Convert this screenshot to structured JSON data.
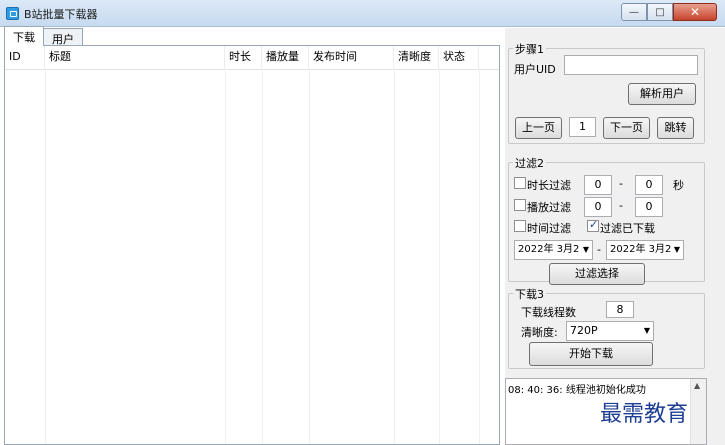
{
  "window": {
    "title": "B站批量下载器",
    "buttons": {
      "minimize": "—",
      "maximize": "□",
      "close": "✕"
    }
  },
  "tabs": [
    {
      "label": "下载",
      "active": true
    },
    {
      "label": "用户",
      "active": false
    }
  ],
  "list": {
    "columns": [
      "ID",
      "标题",
      "时长",
      "播放量",
      "发布时间",
      "清晰度",
      "状态"
    ],
    "rows": []
  },
  "step1": {
    "legend": "步骤1",
    "uid_label": "用户UID",
    "uid_value": "",
    "parse_button": "解析用户",
    "prev_button": "上一页",
    "page_value": "1",
    "next_button": "下一页",
    "jump_button": "跳转"
  },
  "step2": {
    "legend": "过滤2",
    "duration_filter": {
      "label": "时长过滤",
      "checked": false,
      "from": "0",
      "sep": "-",
      "to": "0",
      "unit": "秒"
    },
    "play_filter": {
      "label": "播放过滤",
      "checked": false,
      "from": "0",
      "sep": "-",
      "to": "0"
    },
    "time_filter": {
      "label": "时间过滤",
      "checked": false
    },
    "downloaded_filter": {
      "label": "过滤已下载",
      "checked": true
    },
    "date_from": "2022年 3月2",
    "date_sep": "-",
    "date_to": "2022年 3月2",
    "filter_button": "过滤选择"
  },
  "step3": {
    "legend": "下载3",
    "threads_label": "下载线程数",
    "threads_value": "8",
    "quality_label": "清晰度:",
    "quality_value": "720P",
    "start_button": "开始下载"
  },
  "log": {
    "lines": [
      "08: 40: 36: 线程池初始化成功"
    ]
  },
  "watermark": "最需教育"
}
